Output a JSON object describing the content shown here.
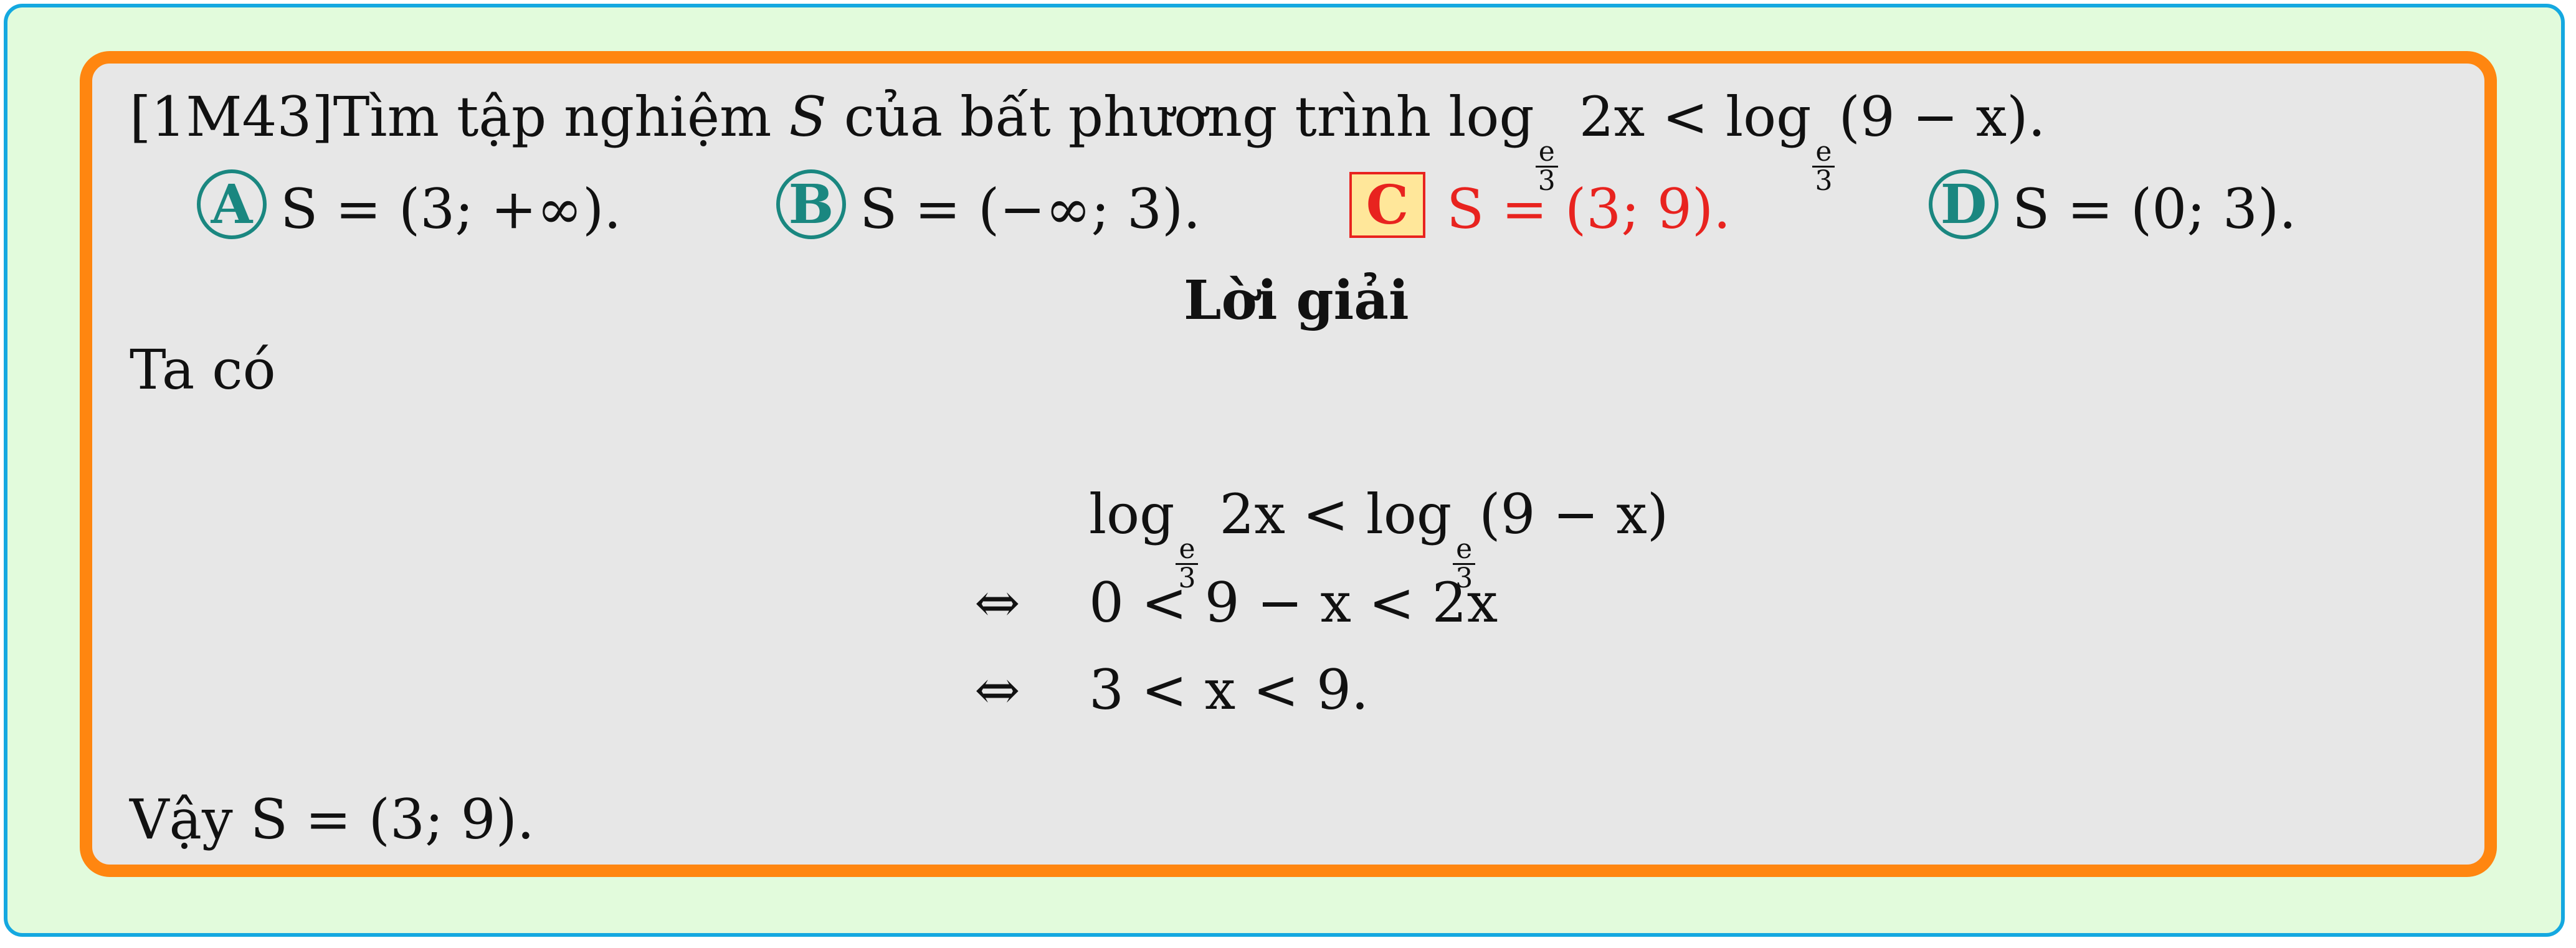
{
  "question": {
    "code": "[1M43]",
    "text": "Tìm tập nghiệm ",
    "var": "S",
    "text2": " của bất phương trình log",
    "ineq_mid": " 2x < log",
    "ineq_end": "(9 − x).",
    "base_num": "e",
    "base_den": "3"
  },
  "options": [
    {
      "letter": "A",
      "text": "S = (3; +∞).",
      "correct": false
    },
    {
      "letter": "B",
      "text": "S = (−∞; 3).",
      "correct": false
    },
    {
      "letter": "C",
      "text": "S = (3; 9).",
      "correct": true
    },
    {
      "letter": "D",
      "text": "S = (0; 3).",
      "correct": false
    }
  ],
  "solution": {
    "heading": "Lời giải",
    "intro": "Ta có",
    "steps": [
      {
        "sym": "",
        "a": "log",
        "b": " 2x < log",
        "c": "(9 − x)"
      },
      {
        "sym": "⇔",
        "text": "0 < 9 − x < 2x"
      },
      {
        "sym": "⇔",
        "text": "3 < x < 9."
      }
    ],
    "conclusion_prefix": "Vậy ",
    "conclusion_math": "S = (3; 9)."
  },
  "colors": {
    "outer_border": "#14a8e0",
    "outer_bg": "#e2fbdc",
    "card_border": "#ff8610",
    "card_bg": "#e7e7e7",
    "option_teal": "#1a8780",
    "correct_red": "#e8231f",
    "correct_bg": "#ffe79a"
  }
}
